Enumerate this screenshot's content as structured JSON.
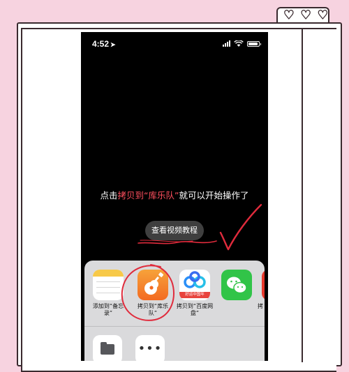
{
  "status_bar": {
    "time": "4:52",
    "location_arrow": "location-arrow-icon"
  },
  "instruction": {
    "part1": "点击",
    "highlight": "拷贝到“库乐队”",
    "part2": "就可以开始操作了"
  },
  "tutorial_button": {
    "label": "查看视频教程"
  },
  "share_sheet": {
    "apps": [
      {
        "label": "添加到“备忘录”",
        "icon": "notes-app-icon"
      },
      {
        "label": "拷贝到“库乐队”",
        "icon": "garageband-app-icon"
      },
      {
        "label": "拷贝到“百度网盘”",
        "icon": "baidu-netdisk-app-icon"
      },
      {
        "label": "",
        "icon": "wechat-app-icon"
      },
      {
        "label": "拷",
        "icon": "app-icon-partial"
      }
    ],
    "baidu_banner": "好运中国年",
    "actions": [
      {
        "icon": "folder-icon"
      },
      {
        "icon": "more-icon"
      }
    ]
  },
  "colors": {
    "background": "#f7d3e0",
    "highlight": "#ff4f5e",
    "annotation": "#e02b3c"
  }
}
